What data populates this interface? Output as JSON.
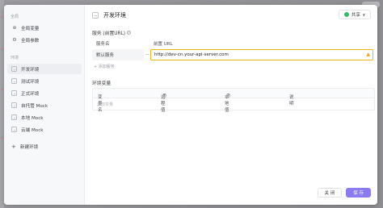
{
  "sidebar": {
    "global_label": "全局",
    "global_items": [
      {
        "label": "全局变量",
        "icon": "globe-icon"
      },
      {
        "label": "全局参数",
        "icon": "gear-icon"
      }
    ],
    "env_label": "环境",
    "env_items": [
      {
        "label": "开发环境",
        "active": true
      },
      {
        "label": "测试环境",
        "active": false
      },
      {
        "label": "正式环境",
        "active": false
      },
      {
        "label": "自托管 Mock",
        "active": false
      },
      {
        "label": "本地 Mock",
        "active": false
      },
      {
        "label": "云端 Mock",
        "active": false
      }
    ],
    "new_env_label": "新建环境"
  },
  "header": {
    "title": "开发环境",
    "share_label": "共享"
  },
  "services": {
    "section_title": "服务 (前置URL)",
    "col_name": "服务名",
    "col_url": "前置 URL",
    "rows": [
      {
        "name": "默认服务",
        "separator": "—",
        "url": "http://dev-cn.your-api-server.com"
      }
    ],
    "add_label": "+ 添加服务"
  },
  "variables": {
    "section_title": "环境变量",
    "col_name": "变量名",
    "col_remote": "远程值",
    "col_local": "本地值",
    "col_desc": "说明",
    "add_placeholder": "添加变量"
  },
  "footer": {
    "close_label": "关 闭",
    "save_label": "保 存"
  },
  "colors": {
    "accent": "#8a7cf0",
    "warning": "#f0b429",
    "share_dot": "#39b86b"
  }
}
